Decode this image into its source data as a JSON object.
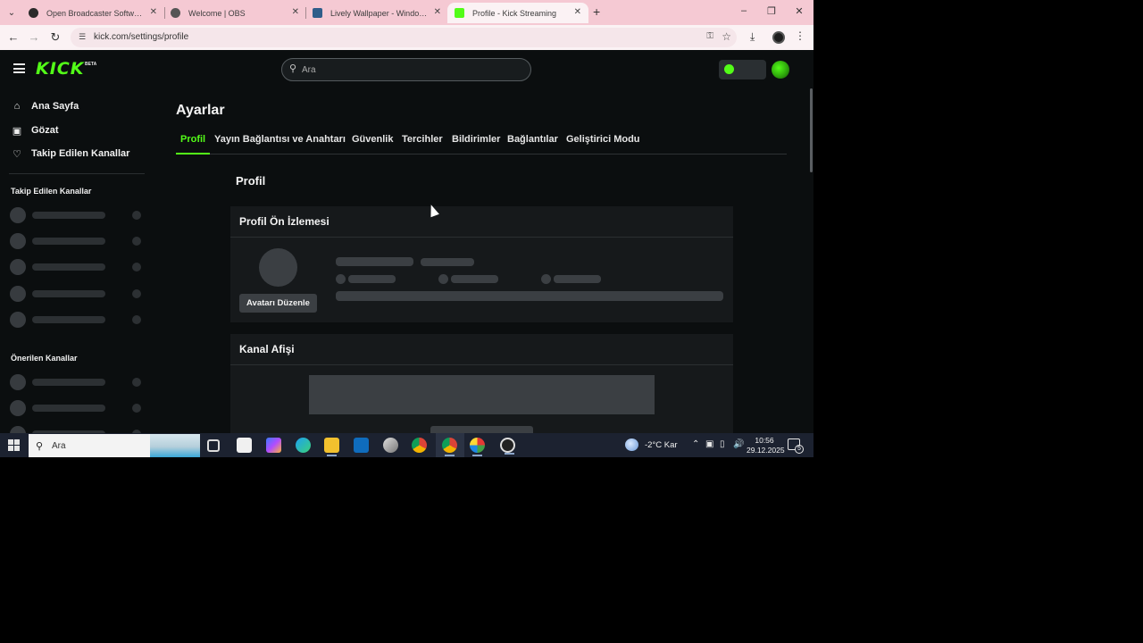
{
  "browser": {
    "tabs": [
      {
        "title": "Open Broadcaster Software | OBS",
        "favicon_color": "#2b2b2b"
      },
      {
        "title": "Welcome | OBS",
        "favicon_color": "#2b2b2b"
      },
      {
        "title": "Lively Wallpaper - Windows'ta a",
        "favicon_color": "#2f5d8a"
      },
      {
        "title": "Profile - Kick Streaming",
        "favicon_color": "#53fc18"
      }
    ],
    "active_tab": 3,
    "url": "kick.com/settings/profile"
  },
  "kick": {
    "logo": "KICK",
    "beta": "BETA",
    "search_placeholder": "Ara",
    "brand_color": "#53fc18"
  },
  "sidebar": {
    "nav": [
      {
        "label": "Ana Sayfa",
        "icon": "home-icon"
      },
      {
        "label": "Gözat",
        "icon": "browse-icon"
      },
      {
        "label": "Takip Edilen Kanallar",
        "icon": "heart-icon"
      }
    ],
    "followed_heading": "Takip Edilen Kanallar",
    "recommended_heading": "Önerilen Kanallar"
  },
  "main": {
    "title": "Ayarlar",
    "tabs": [
      {
        "label": "Profil",
        "active": true
      },
      {
        "label": "Yayın Bağlantısı ve Anahtarı",
        "active": false
      },
      {
        "label": "Güvenlik",
        "active": false
      },
      {
        "label": "Tercihler",
        "active": false
      },
      {
        "label": "Bildirimler",
        "active": false
      },
      {
        "label": "Bağlantılar",
        "active": false
      },
      {
        "label": "Geliştirici Modu",
        "active": false
      }
    ],
    "section_title": "Profil",
    "preview_card": {
      "title": "Profil Ön İzlemesi",
      "edit_avatar_label": "Avatarı Düzenle"
    },
    "banner_card": {
      "title": "Kanal Afişi"
    }
  },
  "taskbar": {
    "search_placeholder": "Ara",
    "weather": "-2°C  Kar",
    "time": "10:56",
    "date": "29.12.2025",
    "notifications": "5"
  }
}
